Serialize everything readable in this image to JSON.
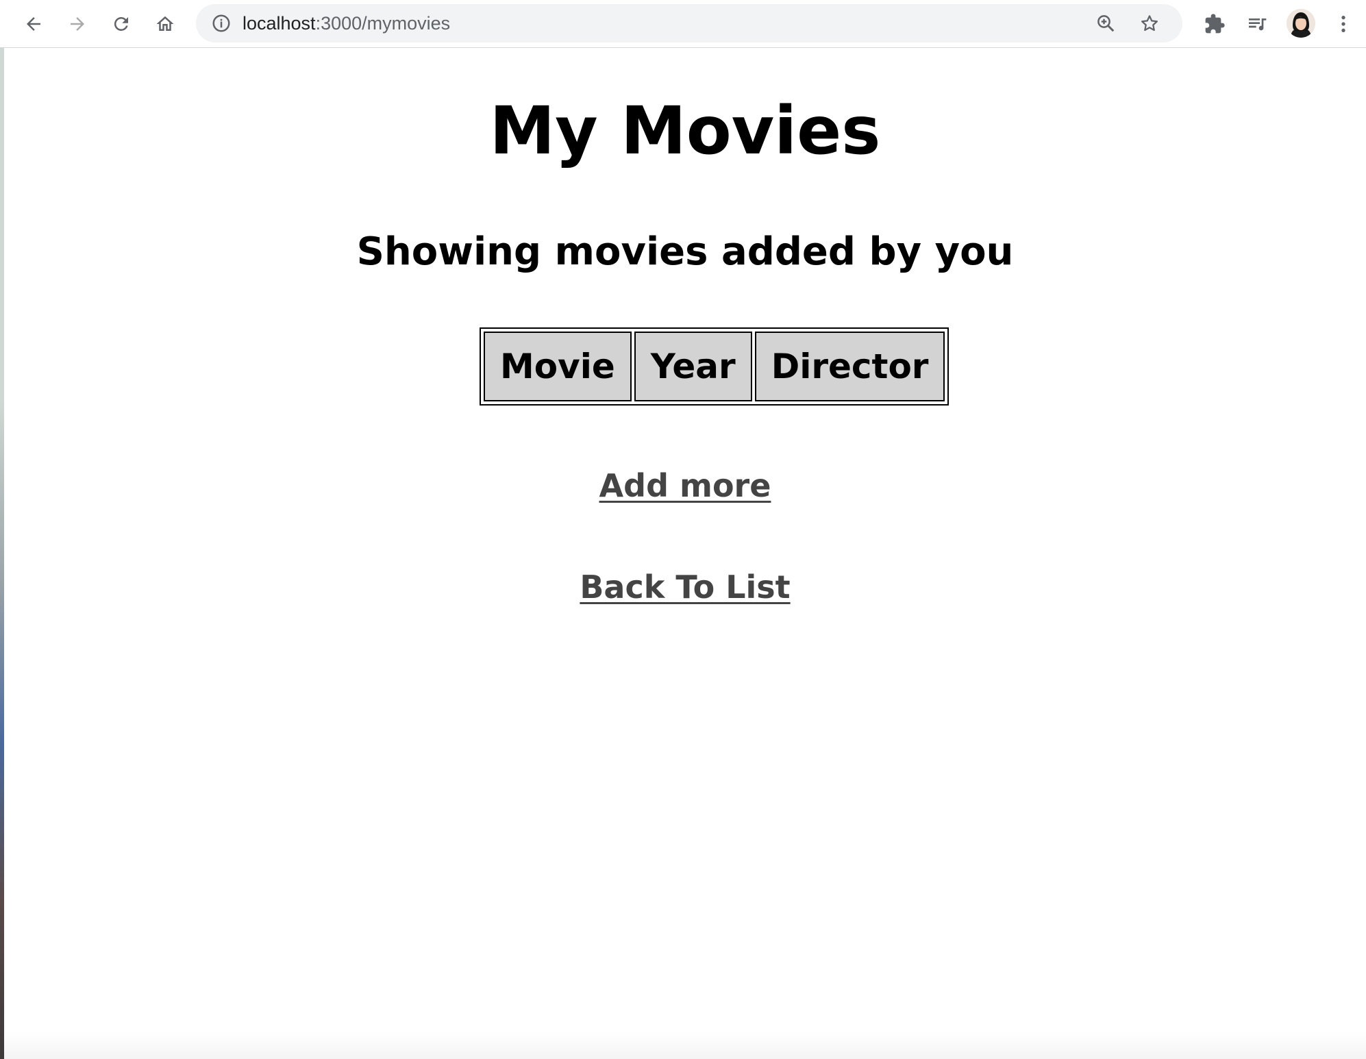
{
  "browser": {
    "url_host": "localhost",
    "url_path": ":3000/mymovies",
    "icons": {
      "back": "arrow-left",
      "forward": "arrow-right",
      "reload": "reload",
      "home": "home",
      "site_info": "info-circle",
      "zoom": "zoom-in",
      "bookmark": "star",
      "extensions": "puzzle",
      "media": "playlist",
      "profile": "avatar",
      "menu": "three-dots-vertical"
    }
  },
  "page": {
    "title": "My Movies",
    "subtitle": "Showing movies added by you",
    "table": {
      "headers": [
        "Movie",
        "Year",
        "Director"
      ],
      "rows": []
    },
    "links": {
      "add_more": "Add more",
      "back_to_list": "Back To List"
    }
  },
  "colors": {
    "header_bg": "#d3d3d3",
    "link_color": "#444444"
  }
}
